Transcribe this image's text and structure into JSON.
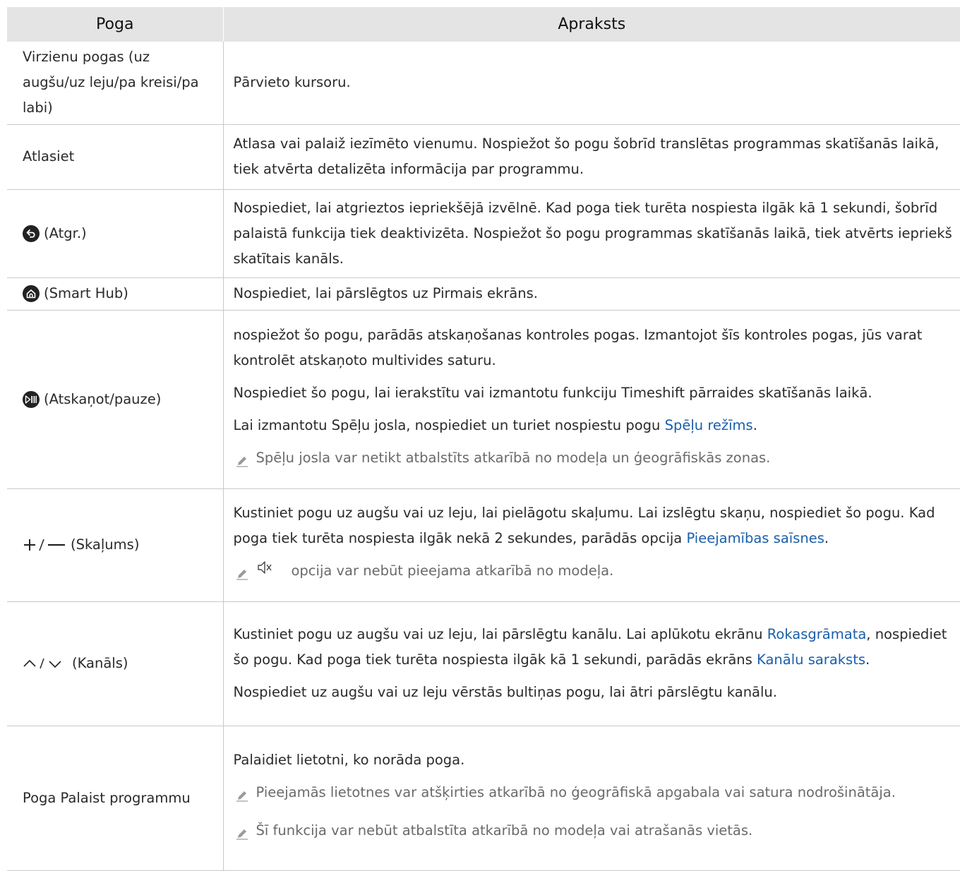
{
  "headers": {
    "col1": "Poga",
    "col2": "Apraksts"
  },
  "rows": {
    "r1": {
      "label": "Virzienu pogas (uz augšu/uz leju/pa kreisi/pa labi)",
      "desc": "Pārvieto kursoru."
    },
    "r2": {
      "label": "Atlasiet",
      "desc": "Atlasa vai palaiž iezīmēto vienumu. Nospiežot šo pogu šobrīd translētas programmas skatīšanās laikā, tiek atvērta detalizēta informācija par programmu."
    },
    "r3": {
      "label": "(Atgr.)",
      "icon": "back-icon",
      "desc": "Nospiediet, lai atgrieztos iepriekšējā izvēlnē. Kad poga tiek turēta nospiesta ilgāk kā 1 sekundi, šobrīd palaistā funkcija tiek deaktivizēta. Nospiežot šo pogu programmas skatīšanās laikā, tiek atvērts iepriekš skatītais kanāls."
    },
    "r4": {
      "label": "(Smart Hub)",
      "icon": "home-icon",
      "desc": "Nospiediet, lai pārslēgtos uz Pirmais ekrāns."
    },
    "r5": {
      "label": "(Atskaņot/pauze)",
      "icon": "play-pause-icon",
      "p1": "nospiežot šo pogu, parādās atskaņošanas kontroles pogas. Izmantojot šīs kontroles pogas, jūs varat kontrolēt atskaņoto multivides saturu.",
      "p2": "Nospiediet šo pogu, lai ierakstītu vai izmantotu funkciju Timeshift pārraides skatīšanās laikā.",
      "p3_pre": "Lai izmantotu Spēļu josla, nospiediet un turiet nospiestu pogu ",
      "p3_link": "Spēļu režīms",
      "p3_post": ".",
      "note": "Spēļu josla var netikt atbalstīts atkarībā no modeļa un ģeogrāfiskās zonas."
    },
    "r6": {
      "label": "(Skaļums)",
      "icon": "plus-minus-icon",
      "p1_pre": "Kustiniet pogu uz augšu vai uz leju, lai pielāgotu skaļumu. Lai izslēgtu skaņu, nospiediet šo pogu. Kad poga tiek turēta nospiesta ilgāk nekā 2 sekundes, parādās opcija ",
      "p1_link": "Pieejamības saīsnes",
      "p1_post": ".",
      "note": "opcija var nebūt pieejama atkarībā no modeļa."
    },
    "r7": {
      "label": "(Kanāls)",
      "icon": "up-down-chevron-icon",
      "p1_a": "Kustiniet pogu uz augšu vai uz leju, lai pārslēgtu kanālu. Lai aplūkotu ekrānu ",
      "p1_link1": "Rokasgrāmata",
      "p1_b": ", nospiediet šo pogu. Kad poga tiek turēta nospiesta ilgāk kā 1 sekundi, parādās ekrāns ",
      "p1_link2": "Kanālu saraksts",
      "p1_c": ".",
      "p2": "Nospiediet uz augšu vai uz leju vērstās bultiņas pogu, lai ātri pārslēgtu kanālu."
    },
    "r8": {
      "label": "Poga Palaist programmu",
      "p1": "Palaidiet lietotni, ko norāda poga.",
      "note1": "Pieejamās lietotnes var atšķirties atkarībā no ģeogrāfiskā apgabala vai satura nodrošinātāja.",
      "note2": "Šī funkcija var nebūt atbalstīta atkarībā no modeļa vai atrašanās vietās."
    }
  }
}
